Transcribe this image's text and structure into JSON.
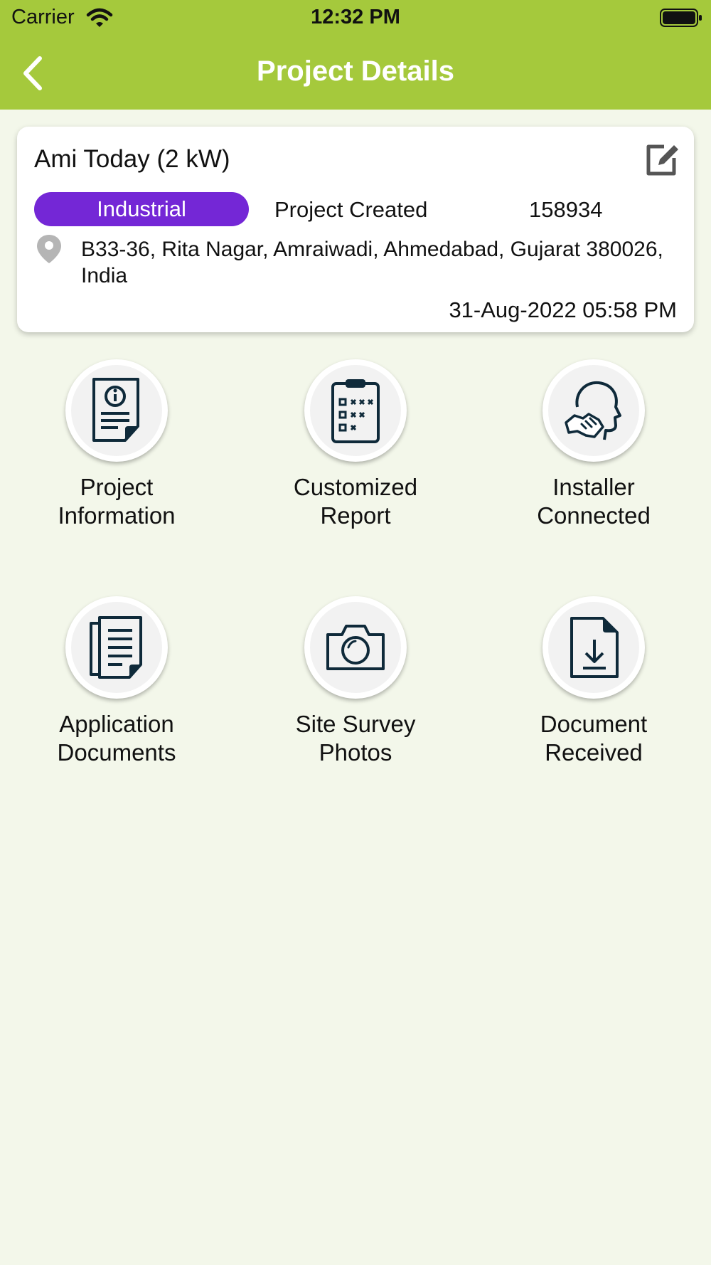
{
  "status_bar": {
    "carrier": "Carrier",
    "time": "12:32 PM"
  },
  "nav": {
    "title": "Project Details"
  },
  "project": {
    "name": "Ami Today (2 kW)",
    "category": "Industrial",
    "status": "Project Created",
    "id": "158934",
    "address": "B33-36, Rita Nagar, Amraiwadi, Ahmedabad, Gujarat 380026, India",
    "date": "31-Aug-2022 05:58 PM"
  },
  "colors": {
    "header": "#a5c93c",
    "badge": "#7427d6",
    "background": "#f3f7ea",
    "icon": "#0f2a3a"
  },
  "tiles": [
    {
      "icon": "info-document-icon",
      "line1": "Project",
      "line2": "Information"
    },
    {
      "icon": "clipboard-checklist-icon",
      "line1": "Customized",
      "line2": "Report"
    },
    {
      "icon": "handshake-head-icon",
      "line1": "Installer",
      "line2": "Connected"
    },
    {
      "icon": "documents-stack-icon",
      "line1": "Application",
      "line2": "Documents"
    },
    {
      "icon": "camera-icon",
      "line1": "Site Survey",
      "line2": "Photos"
    },
    {
      "icon": "document-download-icon",
      "line1": "Document",
      "line2": "Received"
    }
  ]
}
